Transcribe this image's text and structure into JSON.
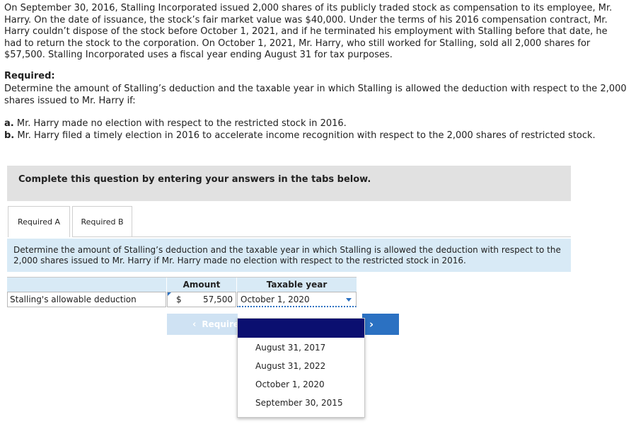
{
  "question": {
    "scenario": "On September 30, 2016, Stalling Incorporated issued 2,000 shares of its publicly traded stock as compensation to its employee, Mr. Harry. On the date of issuance, the stock’s fair market value was $40,000. Under the terms of his 2016 compensation contract, Mr. Harry couldn’t dispose of the stock before October 1, 2021, and if he terminated his employment with Stalling before that date, he had to return the stock to the corporation. On October 1, 2021, Mr. Harry, who still worked for Stalling, sold all 2,000 shares for $57,500. Stalling Incorporated uses a fiscal year ending August 31 for tax purposes.",
    "required_heading": "Required:",
    "required_text": "Determine the amount of Stalling’s deduction and the taxable year in which Stalling is allowed the deduction with respect to the 2,000 shares issued to Mr. Harry if:",
    "parts": [
      {
        "letter": "a.",
        "text": "Mr. Harry made no election with respect to the restricted stock in 2016."
      },
      {
        "letter": "b.",
        "text": "Mr. Harry filed a timely election in 2016 to accelerate income recognition with respect to the 2,000 shares of restricted stock."
      }
    ]
  },
  "complete_banner": "Complete this question by entering your answers in the tabs below.",
  "tabs": [
    {
      "label": "Required A"
    },
    {
      "label": "Required B"
    }
  ],
  "instruction": "Determine the amount of Stalling’s deduction and the taxable year in which Stalling is allowed the deduction with respect to the 2,000 shares issued to Mr. Harry if Mr. Harry made no election with respect to the restricted stock in 2016.",
  "table": {
    "headers": {
      "amount": "Amount",
      "year": "Taxable year"
    },
    "row": {
      "label": "Stalling's allowable deduction",
      "currency": "$",
      "amount": "57,500",
      "year_selected": "October 1, 2020"
    }
  },
  "nav": {
    "prev_chevron": "‹",
    "prev_label": "Require",
    "next_chevron": "›"
  },
  "dropdown_options": [
    "August 31, 2017",
    "August 31, 2022",
    "October 1, 2020",
    "September 30, 2015"
  ],
  "colors": {
    "accent": "#2b71c2",
    "highlight": "#0b0f70",
    "panel": "#d8eaf6"
  }
}
